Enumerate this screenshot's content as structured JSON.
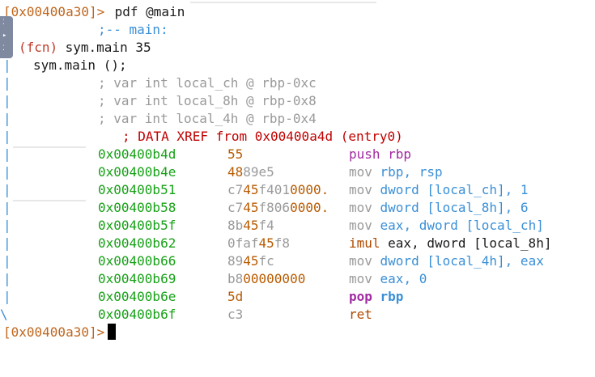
{
  "colors": {
    "prompt": "#c0661d",
    "text": "#1a1a1a",
    "cyan": "#3a8fd6",
    "fcn": "#c03a2b",
    "comment": "#9a9a9a",
    "xref": "#c00000",
    "address": "#16a116",
    "bytes_hi": "#b85a00",
    "bytes_lo": "#9a9a9a",
    "mnemonic": "#9a9a9a",
    "push": "#a12aa1",
    "operand_hi": "#3a8fd6"
  },
  "terminal": {
    "prompt1": "[0x00400a30]>",
    "command": " pdf @main",
    "prompt2": "[0x00400a30]>",
    "main_label": ";-- main:",
    "fcn_prefix": "(fcn)",
    "fcn_name": " sym.main 35",
    "sym_call": "sym.main ();",
    "vars": [
      "; var int local_ch @ rbp-0xc",
      "; var int local_8h @ rbp-0x8",
      "; var int local_4h @ rbp-0x4"
    ],
    "xref": "; DATA XREF from 0x00400a4d (entry0)",
    "instructions": [
      {
        "addr": "0x00400b4d",
        "b1": "55",
        "b2": "",
        "b3": "",
        "b4": "",
        "mn": "push rbp",
        "op": "",
        "op2": "",
        "style": "push"
      },
      {
        "addr": "0x00400b4e",
        "b1": "48",
        "b2": "89e5",
        "b3": "",
        "b4": "",
        "mn": "mov",
        "op": " rbp, rsp",
        "op2": "",
        "style": "mov"
      },
      {
        "addr": "0x00400b51",
        "b1": "c7",
        "b2": "45",
        "b3": "f401",
        "b4": "0000.",
        "mn": "mov",
        "op": " dword [local_ch], 1",
        "op2": "",
        "style": "mov"
      },
      {
        "addr": "0x00400b58",
        "b1": "c7",
        "b2": "45",
        "b3": "f806",
        "b4": "0000.",
        "mn": "mov",
        "op": " dword [local_8h], 6",
        "op2": "",
        "style": "mov"
      },
      {
        "addr": "0x00400b5f",
        "b1": "8b",
        "b2": "45",
        "b3": "f4",
        "b4": "",
        "mn": "mov",
        "op": " eax, dword [local_ch]",
        "op2": "",
        "style": "mov"
      },
      {
        "addr": "0x00400b62",
        "b1": "0faf",
        "b2": "45",
        "b3": "f8",
        "b4": "",
        "mn": "imul",
        "op": " eax, dword [local_8h]",
        "op2": "",
        "style": "imul"
      },
      {
        "addr": "0x00400b66",
        "b1": "89",
        "b2": "45",
        "b3": "fc",
        "b4": "",
        "mn": "mov",
        "op": " dword [local_4h], eax",
        "op2": "",
        "style": "mov"
      },
      {
        "addr": "0x00400b69",
        "b1": "b8",
        "b2": "00000000",
        "b3": "",
        "b4": "",
        "mn": "mov",
        "op": " eax, 0",
        "op2": "",
        "style": "mov"
      },
      {
        "addr": "0x00400b6e",
        "b1": "5d",
        "b2": "",
        "b3": "",
        "b4": "",
        "mn": "pop",
        "op": " rbp",
        "op2": "",
        "style": "pop"
      },
      {
        "addr": "0x00400b6f",
        "b1": "c3",
        "b2": "",
        "b3": "",
        "b4": "",
        "mn": "ret",
        "op": "",
        "op2": "",
        "style": "ret"
      }
    ]
  }
}
